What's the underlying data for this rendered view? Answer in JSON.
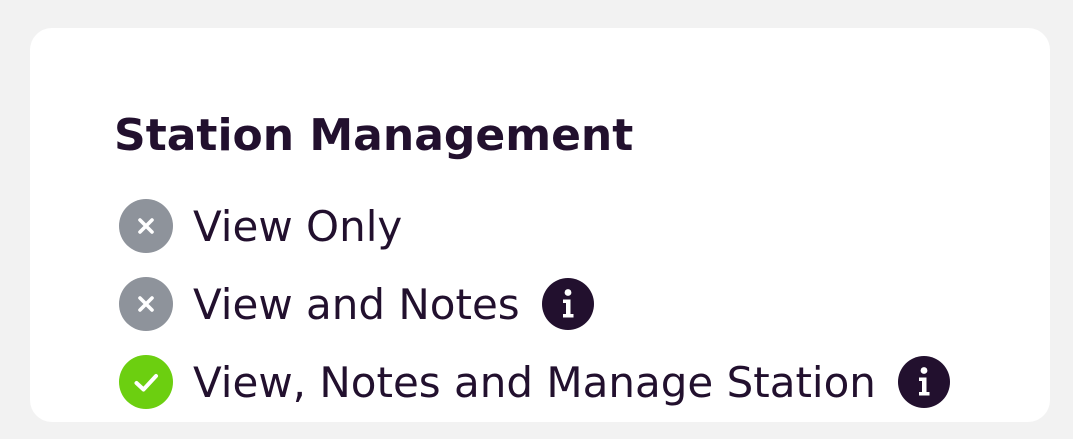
{
  "section": {
    "title": "Station Management"
  },
  "colors": {
    "title_text": "#22102e",
    "disabled_icon": "#8e939b",
    "enabled_icon": "#6ccf10",
    "info_icon": "#22102e",
    "card_background": "#ffffff",
    "page_background": "#f2f2f2"
  },
  "options": [
    {
      "label": "View Only",
      "status": "not-granted",
      "icon": "x-circle-icon",
      "has_info": false
    },
    {
      "label": "View and Notes",
      "status": "not-granted",
      "icon": "x-circle-icon",
      "has_info": true
    },
    {
      "label": "View, Notes and Manage Station",
      "status": "granted",
      "icon": "check-circle-icon",
      "has_info": true
    }
  ]
}
